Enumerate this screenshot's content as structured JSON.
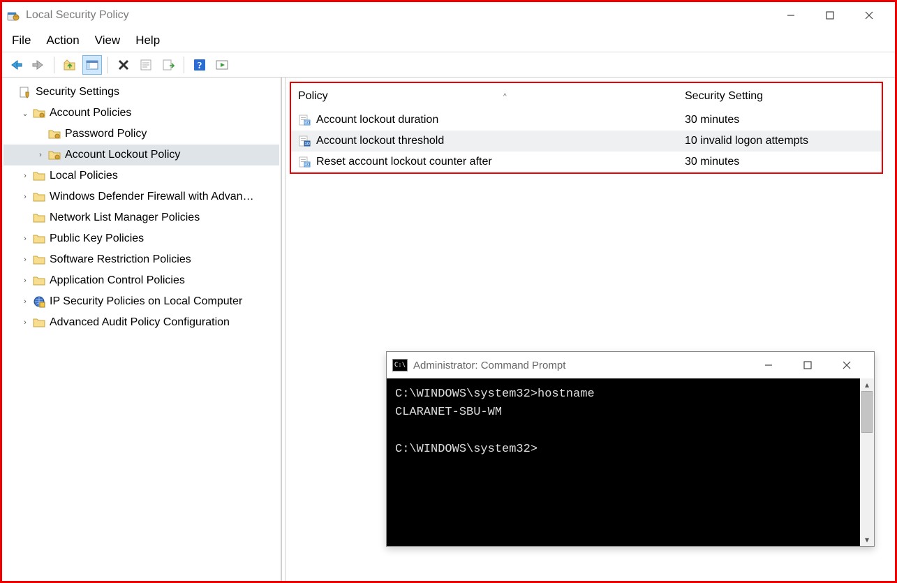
{
  "window": {
    "title": "Local Security Policy",
    "menus": [
      "File",
      "Action",
      "View",
      "Help"
    ]
  },
  "tree": {
    "root": {
      "label": "Security Settings",
      "items": [
        {
          "label": "Account Policies",
          "expanded": true,
          "icon": "folder",
          "children": [
            {
              "label": "Password Policy",
              "icon": "folder",
              "chevron": "none"
            },
            {
              "label": "Account Lockout Policy",
              "icon": "folder",
              "chevron": "right",
              "selected": true
            }
          ]
        },
        {
          "label": "Local Policies",
          "icon": "folder",
          "chevron": "right"
        },
        {
          "label": "Windows Defender Firewall with Advan…",
          "icon": "folder",
          "chevron": "right"
        },
        {
          "label": "Network List Manager Policies",
          "icon": "folder",
          "chevron": "none"
        },
        {
          "label": "Public Key Policies",
          "icon": "folder",
          "chevron": "right"
        },
        {
          "label": "Software Restriction Policies",
          "icon": "folder",
          "chevron": "right"
        },
        {
          "label": "Application Control Policies",
          "icon": "folder",
          "chevron": "right"
        },
        {
          "label": "IP Security Policies on Local Computer",
          "icon": "globe",
          "chevron": "right"
        },
        {
          "label": "Advanced Audit Policy Configuration",
          "icon": "folder",
          "chevron": "right"
        }
      ]
    }
  },
  "details": {
    "columns": [
      "Policy",
      "Security Setting"
    ],
    "rows": [
      {
        "policy": "Account lockout duration",
        "value": "30 minutes",
        "selected": false
      },
      {
        "policy": "Account lockout threshold",
        "value": "10 invalid logon attempts",
        "selected": true
      },
      {
        "policy": "Reset account lockout counter after",
        "value": "30 minutes",
        "selected": false
      }
    ]
  },
  "cmd": {
    "title": "Administrator: Command Prompt",
    "lines": [
      "C:\\WINDOWS\\system32>hostname",
      "CLARANET-SBU-WM",
      "",
      "C:\\WINDOWS\\system32>"
    ]
  }
}
